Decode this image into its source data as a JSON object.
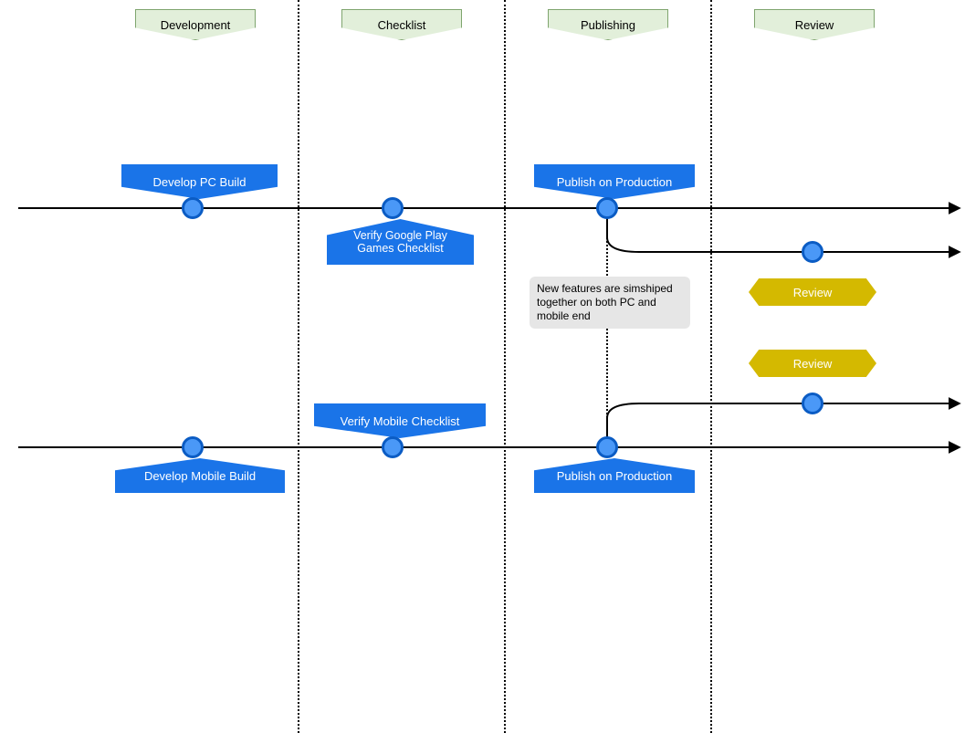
{
  "phases": {
    "development": "Development",
    "checklist": "Checklist",
    "publishing": "Publishing",
    "review": "Review"
  },
  "pc_track": {
    "develop": "Develop PC Build",
    "verify": "Verify Google Play Games Checklist",
    "publish": "Publish on Production",
    "review": "Review"
  },
  "mobile_track": {
    "develop": "Develop Mobile Build",
    "verify": "Verify Mobile Checklist",
    "publish": "Publish on Production",
    "review": "Review"
  },
  "note": "New features are simshiped together on both PC and mobile end"
}
